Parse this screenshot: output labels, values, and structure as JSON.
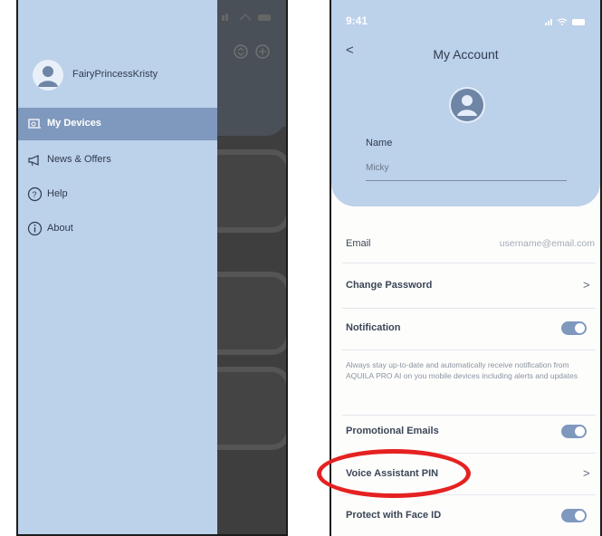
{
  "drawer": {
    "username": "FairyPrincessKristy",
    "items": [
      {
        "label": "My Devices",
        "icon": "devices-icon",
        "active": true
      },
      {
        "label": "News & Offers",
        "icon": "megaphone-icon",
        "active": false
      },
      {
        "label": "Help",
        "icon": "help-icon",
        "active": false
      },
      {
        "label": "About",
        "icon": "info-icon",
        "active": false
      }
    ]
  },
  "account": {
    "time": "9:41",
    "title": "My Account",
    "name_label": "Name",
    "name_value": "Micky",
    "email_label": "Email",
    "email_value": "username@email.com",
    "change_password": "Change Password",
    "notification_label": "Notification",
    "notification_on": true,
    "notification_note": "Always stay up-to-date and automatically receive notification from AQUILA PRO AI on you mobile devices including alerts and updates",
    "promotional_label": "Promotional Emails",
    "promotional_on": true,
    "voice_pin_label": "Voice Assistant PIN",
    "face_id_label": "Protect with Face ID",
    "face_id_on": true
  },
  "colors": {
    "drawer_bg": "#bcd1ea",
    "active_item": "#7f98be",
    "toggle_on": "#7f98be",
    "highlight": "#e52121"
  }
}
